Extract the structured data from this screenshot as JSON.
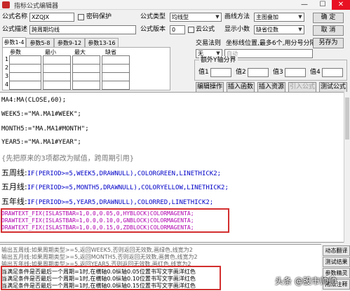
{
  "window": {
    "title": "指标公式编辑器",
    "minimize": "—",
    "maximize": "☐",
    "close": "✕"
  },
  "form": {
    "name_label": "公式名称",
    "name_value": "XZQJX",
    "password_label": "密码保护",
    "desc_label": "公式描述",
    "desc_value": "跨周期均线",
    "type_label": "公式类型",
    "type_value": "均线型",
    "version_label": "公式版本",
    "version_value": "0",
    "cloud_label": "云公式",
    "decimals_label": "显示小数",
    "decimals_value": "缺省位数",
    "draw_label": "画线方法",
    "draw_value": "主图叠加",
    "trade_rule_label": "交易法则",
    "coord_label": "坐标线位置,最多6个,用分号分隔",
    "none_value": "无",
    "auto_value": "自动",
    "extra_y_label": "额外Y轴分界",
    "v1_label": "值1",
    "v2_label": "值2",
    "v3_label": "值3",
    "v4_label": "值4"
  },
  "buttons": {
    "ok": "确 定",
    "cancel": "取 消",
    "save_as": "另存为",
    "edit_op": "编辑操作",
    "insert_func": "插入函数",
    "insert_res": "插入资源",
    "import_formula": "引入公式",
    "test_formula": "测试公式"
  },
  "tabs": [
    "参数1-4",
    "参数5-8",
    "参数9-12",
    "参数13-16"
  ],
  "params": {
    "headers": [
      "参数",
      "最小",
      "最大",
      "缺省"
    ],
    "rows": [
      "1",
      "2",
      "3",
      "4"
    ]
  },
  "code": {
    "l1": "MA4:MA(CLOSE,60);",
    "l2": "WEEK5:=\"MA.MA1#WEEK\";",
    "l3": "MONTH5:=\"MA.MA1#MONTH\";",
    "l4": "YEAR5:=\"MA.MA1#YEAR\";",
    "l5": "{先把原来的3项都改为赋值，跨周期引用}",
    "l6a": "五周线:",
    "l6b": "IF(PERIOD>=5,WEEK5,DRAWNULL),COLORGREEN,LINETHICK2;",
    "l7a": "五月线:",
    "l7b": "IF(PERIOD>=5,MONTH5,DRAWNULL),COLORYELLOW,LINETHICK2;",
    "l8a": "五年线:",
    "l8b": "IF(PERIOD>=5,YEAR5,DRAWNULL),COLORRED,LINETHICK2;",
    "l9": "DRAWTEXT_FIX(ISLASTBAR=1,0.0,0.05,0,HYBLOCK)COLORMAGENTA;",
    "l10": "DRAWTEXT_FIX(ISLASTBAR=1,0.0,0.10,0,GNBLOCK)COLORMAGENTA;",
    "l11": "DRAWTEXT_FIX(ISLASTBAR=1,0.0,0.15,0,ZDBLOCK)COLORMAGENTA;"
  },
  "output": {
    "o1": "输出五周线:如果周期类型>=5,返回WEEK5,否则返回无效数,画绿色,线宽为2",
    "o2": "输出五月线:如果周期类型>=5,返回MONTH5,否则返回无效数,画黄色,线宽为2",
    "o3": "输出五年线:如果周期类型>=5,返回YEAR5,否则返回无效数,画红色,线宽为2",
    "o4": "当满足条件是否最后一个周期=1时,在横轴0.0纵轴0.05位置书写文字画洋红色",
    "o5": "当满足条件是否最后一个周期=1时,在横轴0.0纵轴0.10位置书写文字画洋红色",
    "o6": "当满足条件是否最后一个周期=1时,在横轴0.0纵轴0.15位置书写文字画洋红色"
  },
  "side_buttons": [
    "动态翻译",
    "测试结果",
    "参数精灵",
    "用法注释"
  ],
  "watermark": "头条 @股市帅帅"
}
